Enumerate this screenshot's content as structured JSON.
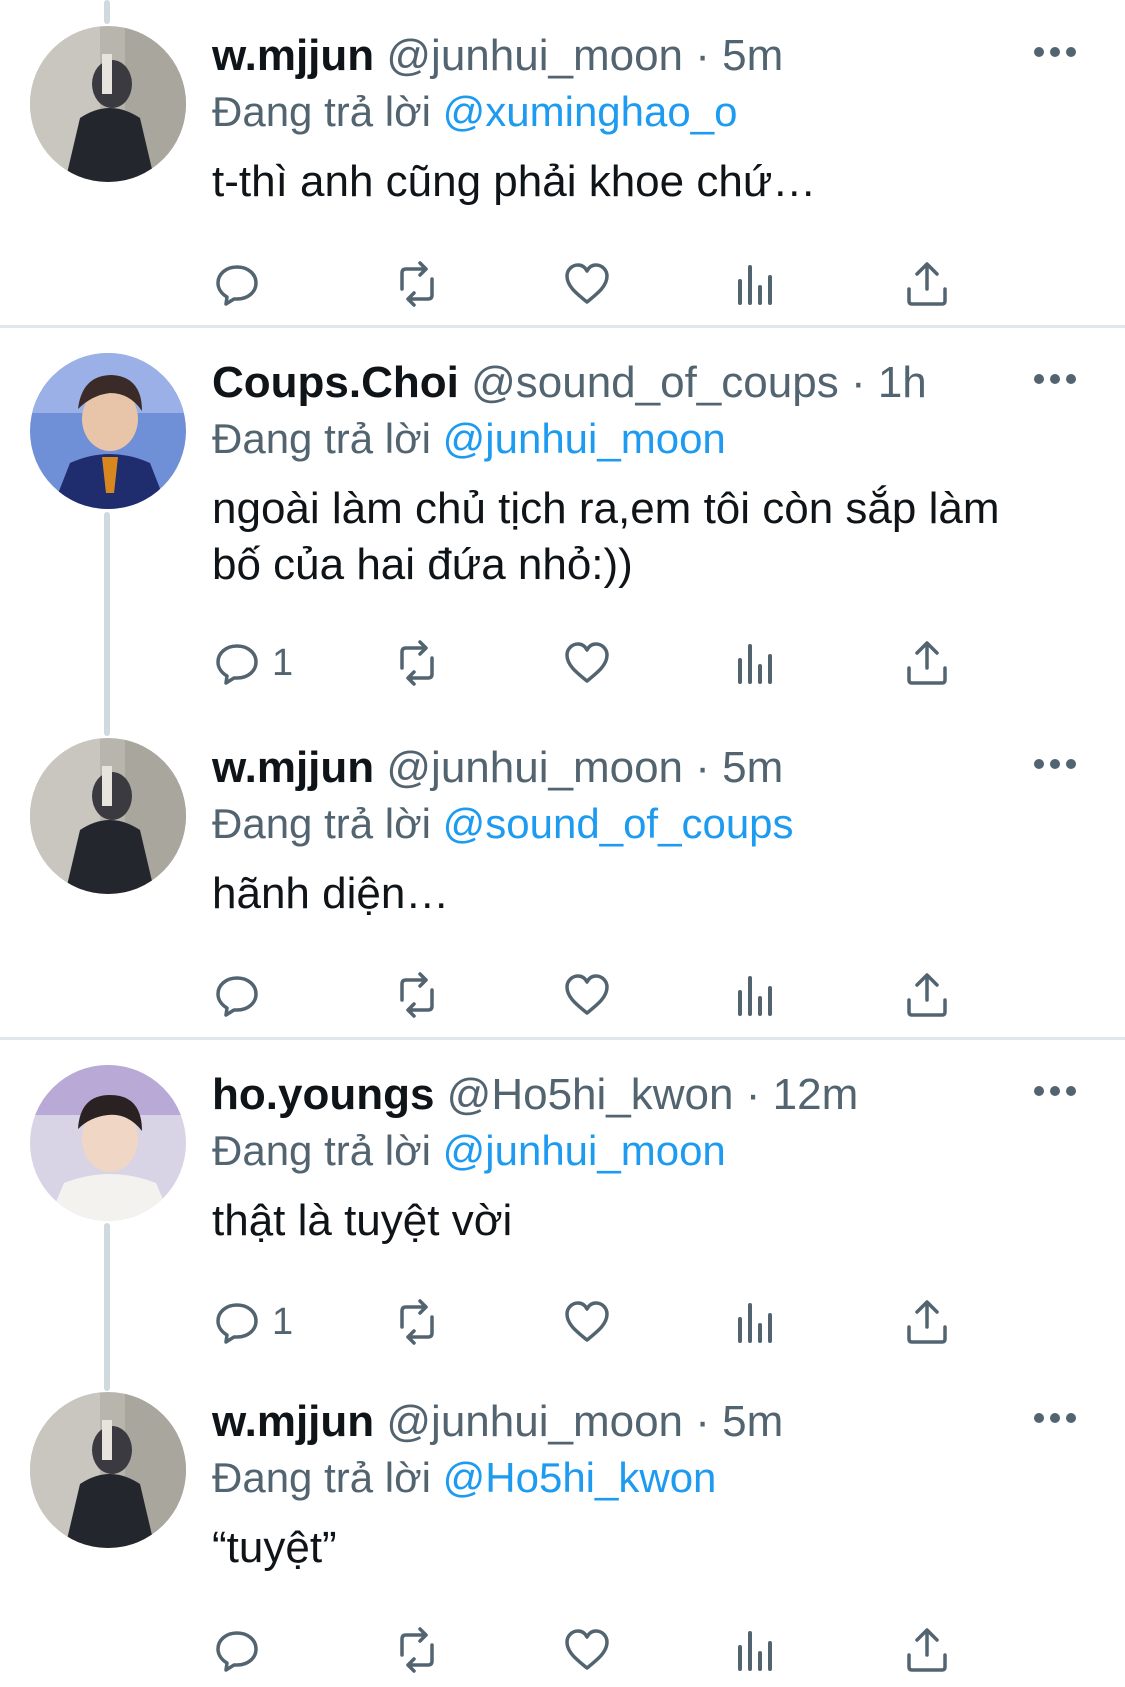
{
  "colors": {
    "accent": "#1d9bf0",
    "secondary_text": "#536471",
    "divider": "#e1e8ed"
  },
  "icons": {
    "more": "more-horizontal-icon",
    "reply": "reply-icon",
    "retweet": "retweet-icon",
    "like": "heart-icon",
    "views": "views-icon",
    "share": "share-icon"
  },
  "reply_prefix": "Đang trả lời",
  "tweets": [
    {
      "name": "w.mjjun",
      "handle": "@junhui_moon",
      "dot": "·",
      "time": "5m",
      "reply_to": "@xuminghao_o",
      "text": "t-thì anh cũng phải khoe chứ…",
      "reply_count": ""
    },
    {
      "name": "Coups.Choi",
      "handle": "@sound_of_coups",
      "dot": "·",
      "time": "1h",
      "reply_to": "@junhui_moon",
      "text": "ngoài làm chủ tịch ra,em tôi còn sắp làm bố của hai đứa nhỏ:))",
      "reply_count": "1"
    },
    {
      "name": "w.mjjun",
      "handle": "@junhui_moon",
      "dot": "·",
      "time": "5m",
      "reply_to": "@sound_of_coups",
      "text": "hãnh diện…",
      "reply_count": ""
    },
    {
      "name": "ho.youngs",
      "handle": "@Ho5hi_kwon",
      "dot": "·",
      "time": "12m",
      "reply_to": "@junhui_moon",
      "text": "thật là tuyệt vời",
      "reply_count": "1"
    },
    {
      "name": "w.mjjun",
      "handle": "@junhui_moon",
      "dot": "·",
      "time": "5m",
      "reply_to": "@Ho5hi_kwon",
      "text": "“tuyệt”",
      "reply_count": ""
    }
  ]
}
